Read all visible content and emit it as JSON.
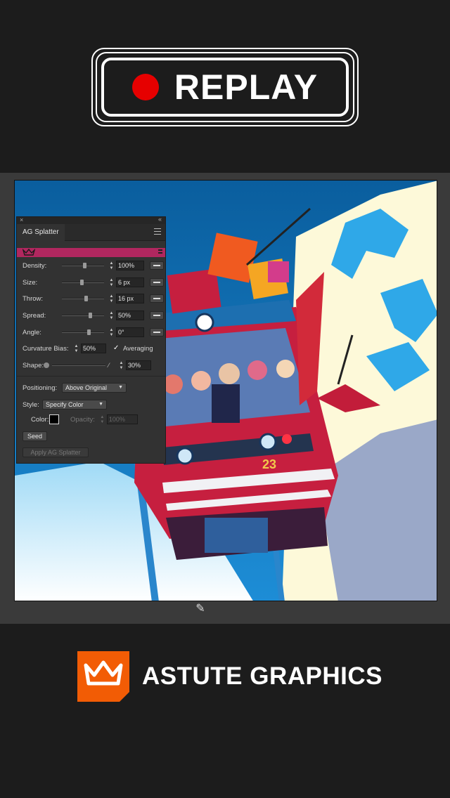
{
  "banner": {
    "label": "REPLAY"
  },
  "colors": {
    "record": "#e60000",
    "brand": "#f25c05",
    "panel_strip": "#b1275f"
  },
  "panel": {
    "title": "AG Splatter",
    "rows": [
      {
        "label": "Density:",
        "value": "100%"
      },
      {
        "label": "Size:",
        "value": "6 px"
      },
      {
        "label": "Throw:",
        "value": "16 px"
      },
      {
        "label": "Spread:",
        "value": "50%"
      },
      {
        "label": "Angle:",
        "value": "0°"
      }
    ],
    "curvature_label": "Curvature Bias:",
    "curvature_value": "50%",
    "averaging_label": "Averaging",
    "shape_label": "Shape:",
    "shape_value": "30%",
    "positioning_label": "Positioning:",
    "positioning_value": "Above Original",
    "style_label": "Style:",
    "style_value": "Specify Color",
    "color_label": "Color:",
    "opacity_label": "Opacity:",
    "opacity_value": "100%",
    "seed_label": "Seed",
    "apply_label": "Apply AG Splatter"
  },
  "artwork": {
    "tram_number": "23"
  },
  "footer": {
    "brand": "ASTUTE GRAPHICS"
  }
}
